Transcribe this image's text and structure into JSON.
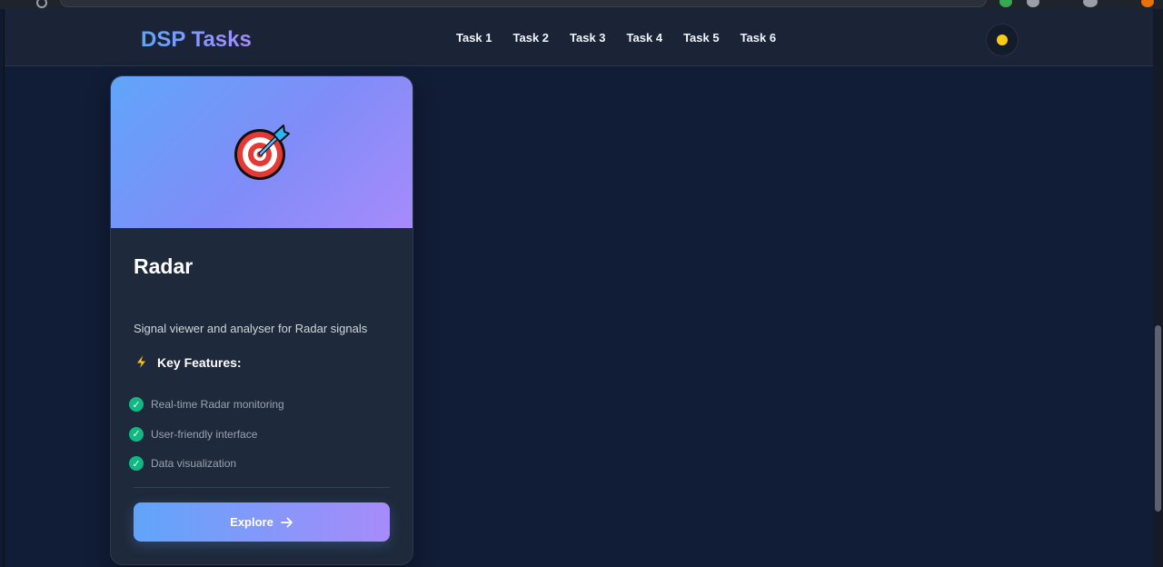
{
  "navbar": {
    "brand": "DSP Tasks",
    "links": [
      "Task 1",
      "Task 2",
      "Task 3",
      "Task 4",
      "Task 5",
      "Task 6"
    ]
  },
  "card": {
    "icon": "target-icon",
    "title": "Radar",
    "description": "Signal viewer and analyser for Radar signals",
    "features_label": "Key Features:",
    "features": [
      "Real-time Radar monitoring",
      "User-friendly interface",
      "Data visualization"
    ],
    "button_label": "Explore"
  },
  "colors": {
    "background": "#111c36",
    "navbar": "#1b2436",
    "card": "#1e293b",
    "gradient_start": "#60a5fa",
    "gradient_end": "#a78bfa",
    "check": "#10b981",
    "sun": "#facc15"
  }
}
